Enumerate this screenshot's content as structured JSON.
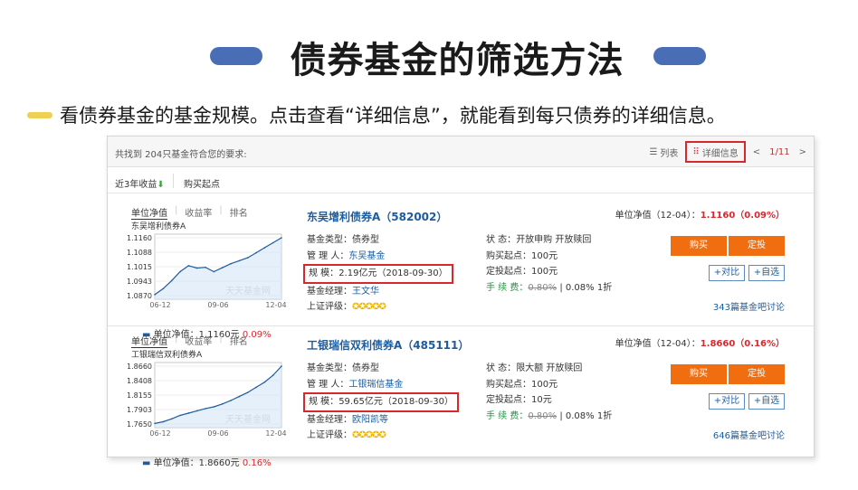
{
  "slide": {
    "title": "债券基金的筛选方法",
    "subtitle": "看债券基金的基金规模。点击查看“详细信息”，就能看到每只债券的详细信息。"
  },
  "toolbar": {
    "count_text": "共找到 204只基金符合您的要求:",
    "list_label": "列表",
    "detail_label": "详细信息",
    "prev": "<",
    "page": "1/11",
    "next": ">",
    "sort_return": "近3年收益",
    "sort_min_buy": "购买起点"
  },
  "funds": [
    {
      "tabs": [
        "单位净值",
        "收益率",
        "排名"
      ],
      "chart_name": "东吴增利债券A",
      "y_ticks": [
        "1.1160",
        "1.1088",
        "1.1015",
        "1.0943",
        "1.0870"
      ],
      "x_ticks": [
        "06-12",
        "09-06",
        "12-04"
      ],
      "watermark": "天天基金网",
      "nav_caption": "单位净值：1.1160元",
      "nav_change": "0.09%",
      "name": "东吴增利债券A（582002）",
      "type_label": "基金类型：",
      "type_value": "债券型",
      "manager_label": "管 理 人：",
      "manager_value": "东吴基金",
      "scale_label": "规    模：",
      "scale_value": "2.19亿元（2018-09-30）",
      "fm_label": "基金经理：",
      "fm_value": "王文华",
      "rating_label": "上证评级：",
      "status_label": "状    态：",
      "status_value": "开放申购  开放赎回",
      "minbuy_label": "购买起点：",
      "minbuy_value": "100元",
      "minsip_label": "定投起点：",
      "minsip_value": "100元",
      "fee_label": "手 续 费：",
      "fee_orig": "0.80%",
      "fee_sep": "|",
      "fee_disc": "0.08%",
      "fee_note": "1折",
      "nav_label": "单位净值（12-04）：",
      "nav_value": "1.1160（0.09%）",
      "buy_label": "购买",
      "sip_label": "定投",
      "compare_label": "+对比",
      "watch_label": "+自选",
      "bbs": "343篇基金吧讨论",
      "chart_data": {
        "type": "line",
        "x": [
          "06-12",
          "09-06",
          "12-04"
        ],
        "ylim": [
          1.087,
          1.116
        ],
        "series": [
          {
            "values": [
              1.0875,
              1.0905,
              1.0945,
              1.099,
              1.102,
              1.1008,
              1.1012,
              1.099,
              1.101,
              1.103,
              1.1045,
              1.106,
              1.1085,
              1.111,
              1.1135,
              1.116
            ]
          }
        ]
      }
    },
    {
      "tabs": [
        "单位净值",
        "收益率",
        "排名"
      ],
      "chart_name": "工银瑞信双利债券A",
      "y_ticks": [
        "1.8660",
        "1.8408",
        "1.8155",
        "1.7903",
        "1.7650"
      ],
      "x_ticks": [
        "06-12",
        "09-06",
        "12-04"
      ],
      "watermark": "天天基金网",
      "nav_caption": "单位净值：1.8660元",
      "nav_change": "0.16%",
      "name": "工银瑞信双利债券A（485111）",
      "type_label": "基金类型：",
      "type_value": "债券型",
      "manager_label": "管 理 人：",
      "manager_value": "工银瑞信基金",
      "scale_label": "规    模：",
      "scale_value": "59.65亿元（2018-09-30）",
      "fm_label": "基金经理：",
      "fm_value": "欧阳凯等",
      "rating_label": "上证评级：",
      "status_label": "状    态：",
      "status_value": "限大额  开放赎回",
      "minbuy_label": "购买起点：",
      "minbuy_value": "100元",
      "minsip_label": "定投起点：",
      "minsip_value": "10元",
      "fee_label": "手 续 费：",
      "fee_orig": "0.80%",
      "fee_sep": "|",
      "fee_disc": "0.08%",
      "fee_note": "1折",
      "nav_label": "单位净值（12-04）：",
      "nav_value": "1.8660（0.16%）",
      "buy_label": "购买",
      "sip_label": "定投",
      "compare_label": "+对比",
      "watch_label": "+自选",
      "bbs": "646篇基金吧讨论",
      "chart_data": {
        "type": "line",
        "x": [
          "06-12",
          "09-06",
          "12-04"
        ],
        "ylim": [
          1.765,
          1.866
        ],
        "series": [
          {
            "values": [
              1.766,
              1.769,
              1.774,
              1.78,
              1.784,
              1.788,
              1.792,
              1.795,
              1.8,
              1.806,
              1.813,
              1.82,
              1.829,
              1.838,
              1.85,
              1.866
            ]
          }
        ]
      }
    }
  ],
  "colors": {
    "accent_red": "#d9272e",
    "link_blue": "#1c5c9e",
    "buy_orange": "#f06e10",
    "pill_blue": "#4a6eb5",
    "bullet_yellow": "#f0cf55"
  }
}
